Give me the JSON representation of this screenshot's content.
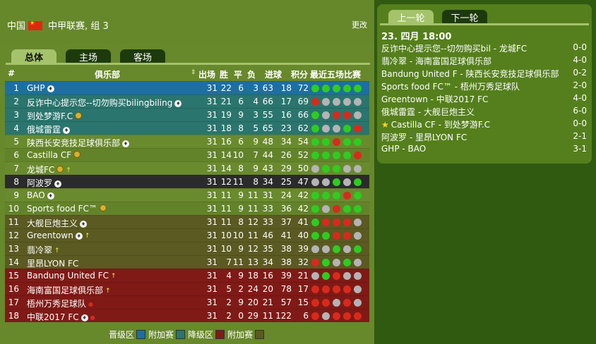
{
  "header": {
    "country": "中国",
    "league": "中甲联赛, 组 3",
    "change_label": "更改"
  },
  "tabs": [
    "总体",
    "主场",
    "客场"
  ],
  "table_headers": {
    "rank": "#",
    "club": "俱乐部",
    "played": "出场",
    "won": "胜",
    "drawn": "平",
    "lost": "负",
    "goals": "进球",
    "points": "积分",
    "form": "最近五场比赛"
  },
  "standings": [
    {
      "rank": "1",
      "team": "GHP",
      "marker": "shield",
      "played": "31",
      "won": "22",
      "drawn": "6",
      "lost": "3",
      "gf": "63",
      "ga": "18",
      "pts": "72",
      "form": [
        "W",
        "W",
        "W",
        "W",
        "W"
      ],
      "zone": "promotion"
    },
    {
      "rank": "2",
      "team": "反诈中心提示您--切勿购买bilingbiling",
      "marker": "shield",
      "played": "31",
      "won": "21",
      "drawn": "6",
      "lost": "4",
      "gf": "66",
      "ga": "17",
      "pts": "69",
      "form": [
        "L",
        "D",
        "D",
        "D",
        "D"
      ],
      "zone": "relegation-playoff-up"
    },
    {
      "rank": "3",
      "team": "到处梦游F.C",
      "marker": "coin",
      "played": "31",
      "won": "19",
      "drawn": "9",
      "lost": "3",
      "gf": "55",
      "ga": "16",
      "pts": "66",
      "form": [
        "W",
        "D",
        "L",
        "L",
        "D"
      ],
      "zone": "relegation-playoff-up"
    },
    {
      "rank": "4",
      "team": "俄城雷霆",
      "marker": "shield",
      "played": "31",
      "won": "18",
      "drawn": "8",
      "lost": "5",
      "gf": "65",
      "ga": "23",
      "pts": "62",
      "form": [
        "W",
        "D",
        "D",
        "W",
        "L"
      ],
      "zone": "relegation-playoff-up"
    },
    {
      "rank": "5",
      "team": "陕西长安竞技足球俱乐部",
      "marker": "shield",
      "played": "31",
      "won": "16",
      "drawn": "6",
      "lost": "9",
      "gf": "48",
      "ga": "34",
      "pts": "54",
      "form": [
        "W",
        "W",
        "L",
        "W",
        "W"
      ],
      "zone": ""
    },
    {
      "rank": "6",
      "team": "Castilla CF",
      "marker": "coin",
      "played": "31",
      "won": "14",
      "drawn": "10",
      "lost": "7",
      "gf": "44",
      "ga": "26",
      "pts": "52",
      "form": [
        "W",
        "W",
        "W",
        "W",
        "L"
      ],
      "zone": ""
    },
    {
      "rank": "7",
      "team": "龙城FC",
      "marker": "coin-up",
      "played": "31",
      "won": "14",
      "drawn": "8",
      "lost": "9",
      "gf": "43",
      "ga": "29",
      "pts": "50",
      "form": [
        "D",
        "W",
        "W",
        "D",
        "D"
      ],
      "zone": ""
    },
    {
      "rank": "8",
      "team": "阿波罗",
      "marker": "shield",
      "played": "31",
      "won": "12",
      "drawn": "11",
      "lost": "8",
      "gf": "34",
      "ga": "25",
      "pts": "47",
      "form": [
        "D",
        "D",
        "W",
        "D",
        "W"
      ],
      "zone": "mine"
    },
    {
      "rank": "9",
      "team": "BAO",
      "marker": "shield",
      "played": "31",
      "won": "11",
      "drawn": "9",
      "lost": "11",
      "gf": "31",
      "ga": "24",
      "pts": "42",
      "form": [
        "W",
        "W",
        "W",
        "L",
        "W"
      ],
      "zone": ""
    },
    {
      "rank": "10",
      "team": "Sports food FC™",
      "marker": "coin",
      "played": "31",
      "won": "11",
      "drawn": "9",
      "lost": "11",
      "gf": "33",
      "ga": "36",
      "pts": "42",
      "form": [
        "W",
        "D",
        "L",
        "W",
        "W"
      ],
      "zone": ""
    },
    {
      "rank": "11",
      "team": "大舰巨炮主义",
      "marker": "shield",
      "played": "31",
      "won": "11",
      "drawn": "8",
      "lost": "12",
      "gf": "33",
      "ga": "37",
      "pts": "41",
      "form": [
        "W",
        "L",
        "L",
        "L",
        "D"
      ],
      "zone": "playoff"
    },
    {
      "rank": "12",
      "team": "Greentown",
      "marker": "shield-up",
      "played": "31",
      "won": "10",
      "drawn": "10",
      "lost": "11",
      "gf": "46",
      "ga": "41",
      "pts": "40",
      "form": [
        "W",
        "W",
        "L",
        "L",
        "D"
      ],
      "zone": "playoff"
    },
    {
      "rank": "13",
      "team": "翡冷翠",
      "marker": "up",
      "played": "31",
      "won": "10",
      "drawn": "9",
      "lost": "12",
      "gf": "35",
      "ga": "38",
      "pts": "39",
      "form": [
        "D",
        "D",
        "W",
        "D",
        "W"
      ],
      "zone": "playoff"
    },
    {
      "rank": "14",
      "team": "里昂LYON FC",
      "marker": "",
      "played": "31",
      "won": "7",
      "drawn": "11",
      "lost": "13",
      "gf": "34",
      "ga": "38",
      "pts": "32",
      "form": [
        "L",
        "W",
        "D",
        "W",
        "D"
      ],
      "zone": "playoff"
    },
    {
      "rank": "15",
      "team": "Bandung United FC",
      "marker": "up",
      "played": "31",
      "won": "4",
      "drawn": "9",
      "lost": "18",
      "gf": "16",
      "ga": "39",
      "pts": "21",
      "form": [
        "D",
        "W",
        "L",
        "D",
        "D"
      ],
      "zone": "relegation"
    },
    {
      "rank": "16",
      "team": "海南富国足球俱乐部",
      "marker": "up",
      "played": "31",
      "won": "5",
      "drawn": "2",
      "lost": "24",
      "gf": "20",
      "ga": "78",
      "pts": "17",
      "form": [
        "L",
        "L",
        "L",
        "L",
        "D"
      ],
      "zone": "relegation"
    },
    {
      "rank": "17",
      "team": "梧州万秀足球队",
      "marker": "down",
      "played": "31",
      "won": "2",
      "drawn": "9",
      "lost": "20",
      "gf": "21",
      "ga": "57",
      "pts": "15",
      "form": [
        "L",
        "L",
        "D",
        "L",
        "D"
      ],
      "zone": "relegation"
    },
    {
      "rank": "18",
      "team": "中联2017 FC",
      "marker": "shield-down",
      "played": "31",
      "won": "2",
      "drawn": "0",
      "lost": "29",
      "gf": "11",
      "ga": "122",
      "pts": "6",
      "form": [
        "L",
        "D",
        "L",
        "L",
        "L"
      ],
      "zone": "relegation"
    }
  ],
  "legend": {
    "promotion": "晋级区",
    "promotion_playoff": "附加赛",
    "relegation": "降级区",
    "relegation_playoff": "附加赛"
  },
  "colors": {
    "promotion": "#1d6fa1",
    "relegation-playoff-up": "#2a756d",
    "mine": "#2b2b2b",
    "playoff": "#5a5a22",
    "relegation": "#7f1a16",
    "row_default": "#6a8a2e",
    "row_alt": "#66852b"
  },
  "fixtures": {
    "prev_label": "上一轮",
    "next_label": "下一轮",
    "date": "23. 四月 18:00",
    "matches": [
      {
        "teams": "反诈中心提示您--切勿购买bil - 龙城FC",
        "score": "0-0",
        "star": false
      },
      {
        "teams": "翡冷翠 - 海南富国足球俱乐部",
        "score": "4-0",
        "star": false
      },
      {
        "teams": "Bandung United F - 陕西长安竞技足球俱乐部",
        "score": "0-2",
        "star": false
      },
      {
        "teams": "Sports food FC™ - 梧州万秀足球队",
        "score": "2-0",
        "star": false
      },
      {
        "teams": "Greentown - 中联2017 FC",
        "score": "4-0",
        "star": false
      },
      {
        "teams": "俄城雷霆 - 大舰巨炮主义",
        "score": "6-0",
        "star": false
      },
      {
        "teams": "Castilla CF - 到处梦游F.C",
        "score": "0-0",
        "star": true
      },
      {
        "teams": "阿波罗 - 里昂LYON FC",
        "score": "2-1",
        "star": false
      },
      {
        "teams": "GHP - BAO",
        "score": "3-1",
        "star": false
      }
    ]
  }
}
